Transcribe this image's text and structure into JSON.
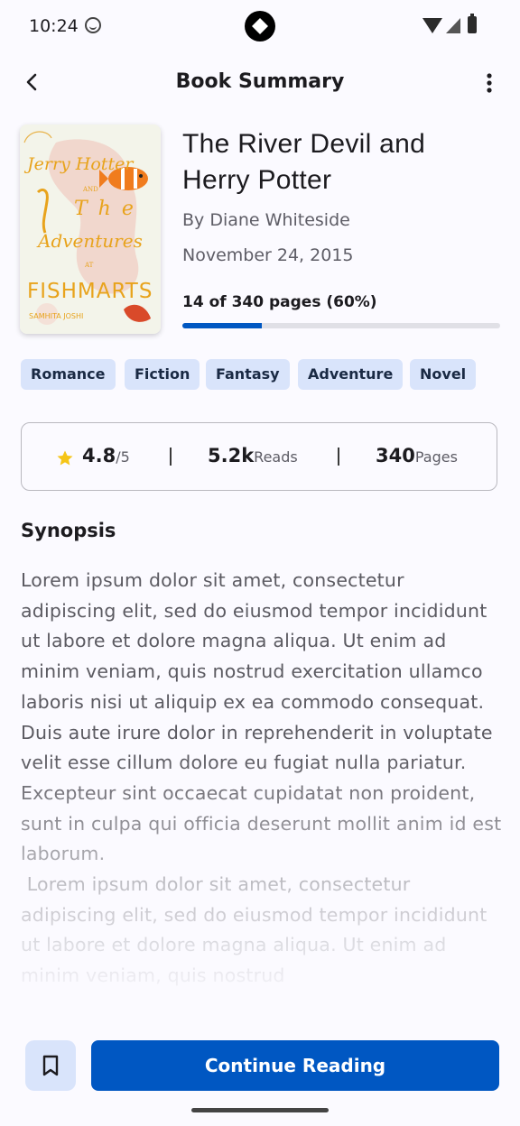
{
  "status": {
    "time": "10:24"
  },
  "topbar": {
    "title": "Book Summary"
  },
  "book": {
    "cover_lines": [
      "Jerry Hotter",
      "AND",
      "The",
      "Adventures",
      "AT",
      "FISHMARTS",
      "SAMHITA JOSHI"
    ],
    "title": "The River Devil and Herry Potter",
    "author": "By Diane Whiteside",
    "date": "November 24, 2015",
    "progress_text": "14 of 340 pages (60%)",
    "progress_fraction": 0.25
  },
  "tags": [
    "Romance",
    "Fiction",
    "Fantasy",
    "Adventure",
    "Novel"
  ],
  "stats": {
    "rating": "4.8",
    "rating_unit": "/5",
    "reads": "5.2k",
    "reads_unit": "Reads",
    "pages": "340",
    "pages_unit": "Pages"
  },
  "synopsis": {
    "heading": "Synopsis",
    "text": "Lorem ipsum dolor sit amet, consectetur adipiscing elit, sed do eiusmod tempor incididunt ut labore et dolore magna aliqua. Ut enim ad minim veniam, quis nostrud exercitation ullamco laboris nisi ut aliquip ex ea commodo consequat. Duis aute irure dolor in reprehenderit in voluptate velit esse cillum dolore eu fugiat nulla pariatur. Excepteur sint occaecat cupidatat non proident, sunt in culpa qui officia deserunt mollit anim id est laborum.\n Lorem ipsum dolor sit amet, consectetur adipiscing elit, sed do eiusmod tempor incididunt ut labore et dolore magna aliqua. Ut enim ad minim veniam, quis nostrud"
  },
  "actions": {
    "continue_label": "Continue Reading"
  },
  "colors": {
    "accent": "#0057c2",
    "chip_bg": "#d9e4fb",
    "cover_text": "#e8a31c"
  }
}
